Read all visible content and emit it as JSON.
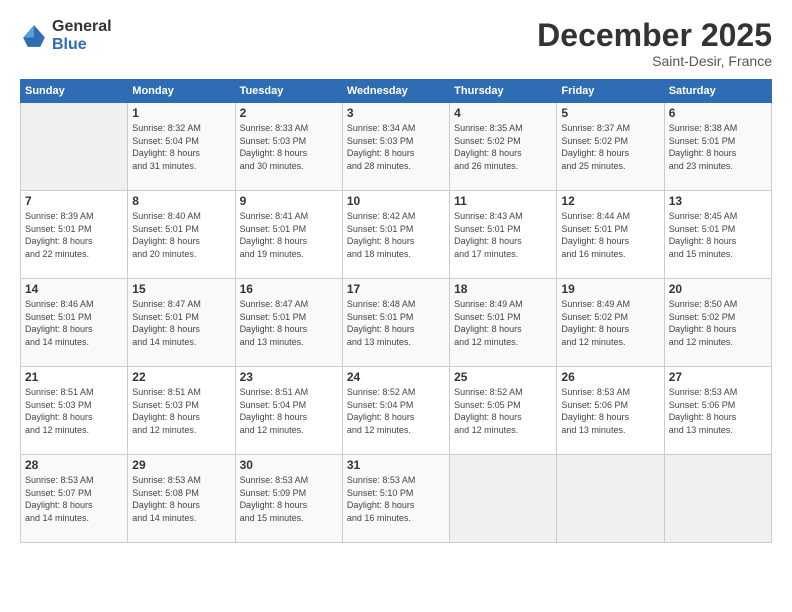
{
  "logo": {
    "general": "General",
    "blue": "Blue"
  },
  "title": "December 2025",
  "subtitle": "Saint-Desir, France",
  "weekdays": [
    "Sunday",
    "Monday",
    "Tuesday",
    "Wednesday",
    "Thursday",
    "Friday",
    "Saturday"
  ],
  "weeks": [
    [
      {
        "day": "",
        "info": ""
      },
      {
        "day": "1",
        "info": "Sunrise: 8:32 AM\nSunset: 5:04 PM\nDaylight: 8 hours\nand 31 minutes."
      },
      {
        "day": "2",
        "info": "Sunrise: 8:33 AM\nSunset: 5:03 PM\nDaylight: 8 hours\nand 30 minutes."
      },
      {
        "day": "3",
        "info": "Sunrise: 8:34 AM\nSunset: 5:03 PM\nDaylight: 8 hours\nand 28 minutes."
      },
      {
        "day": "4",
        "info": "Sunrise: 8:35 AM\nSunset: 5:02 PM\nDaylight: 8 hours\nand 26 minutes."
      },
      {
        "day": "5",
        "info": "Sunrise: 8:37 AM\nSunset: 5:02 PM\nDaylight: 8 hours\nand 25 minutes."
      },
      {
        "day": "6",
        "info": "Sunrise: 8:38 AM\nSunset: 5:01 PM\nDaylight: 8 hours\nand 23 minutes."
      }
    ],
    [
      {
        "day": "7",
        "info": "Sunrise: 8:39 AM\nSunset: 5:01 PM\nDaylight: 8 hours\nand 22 minutes."
      },
      {
        "day": "8",
        "info": "Sunrise: 8:40 AM\nSunset: 5:01 PM\nDaylight: 8 hours\nand 20 minutes."
      },
      {
        "day": "9",
        "info": "Sunrise: 8:41 AM\nSunset: 5:01 PM\nDaylight: 8 hours\nand 19 minutes."
      },
      {
        "day": "10",
        "info": "Sunrise: 8:42 AM\nSunset: 5:01 PM\nDaylight: 8 hours\nand 18 minutes."
      },
      {
        "day": "11",
        "info": "Sunrise: 8:43 AM\nSunset: 5:01 PM\nDaylight: 8 hours\nand 17 minutes."
      },
      {
        "day": "12",
        "info": "Sunrise: 8:44 AM\nSunset: 5:01 PM\nDaylight: 8 hours\nand 16 minutes."
      },
      {
        "day": "13",
        "info": "Sunrise: 8:45 AM\nSunset: 5:01 PM\nDaylight: 8 hours\nand 15 minutes."
      }
    ],
    [
      {
        "day": "14",
        "info": "Sunrise: 8:46 AM\nSunset: 5:01 PM\nDaylight: 8 hours\nand 14 minutes."
      },
      {
        "day": "15",
        "info": "Sunrise: 8:47 AM\nSunset: 5:01 PM\nDaylight: 8 hours\nand 14 minutes."
      },
      {
        "day": "16",
        "info": "Sunrise: 8:47 AM\nSunset: 5:01 PM\nDaylight: 8 hours\nand 13 minutes."
      },
      {
        "day": "17",
        "info": "Sunrise: 8:48 AM\nSunset: 5:01 PM\nDaylight: 8 hours\nand 13 minutes."
      },
      {
        "day": "18",
        "info": "Sunrise: 8:49 AM\nSunset: 5:01 PM\nDaylight: 8 hours\nand 12 minutes."
      },
      {
        "day": "19",
        "info": "Sunrise: 8:49 AM\nSunset: 5:02 PM\nDaylight: 8 hours\nand 12 minutes."
      },
      {
        "day": "20",
        "info": "Sunrise: 8:50 AM\nSunset: 5:02 PM\nDaylight: 8 hours\nand 12 minutes."
      }
    ],
    [
      {
        "day": "21",
        "info": "Sunrise: 8:51 AM\nSunset: 5:03 PM\nDaylight: 8 hours\nand 12 minutes."
      },
      {
        "day": "22",
        "info": "Sunrise: 8:51 AM\nSunset: 5:03 PM\nDaylight: 8 hours\nand 12 minutes."
      },
      {
        "day": "23",
        "info": "Sunrise: 8:51 AM\nSunset: 5:04 PM\nDaylight: 8 hours\nand 12 minutes."
      },
      {
        "day": "24",
        "info": "Sunrise: 8:52 AM\nSunset: 5:04 PM\nDaylight: 8 hours\nand 12 minutes."
      },
      {
        "day": "25",
        "info": "Sunrise: 8:52 AM\nSunset: 5:05 PM\nDaylight: 8 hours\nand 12 minutes."
      },
      {
        "day": "26",
        "info": "Sunrise: 8:53 AM\nSunset: 5:06 PM\nDaylight: 8 hours\nand 13 minutes."
      },
      {
        "day": "27",
        "info": "Sunrise: 8:53 AM\nSunset: 5:06 PM\nDaylight: 8 hours\nand 13 minutes."
      }
    ],
    [
      {
        "day": "28",
        "info": "Sunrise: 8:53 AM\nSunset: 5:07 PM\nDaylight: 8 hours\nand 14 minutes."
      },
      {
        "day": "29",
        "info": "Sunrise: 8:53 AM\nSunset: 5:08 PM\nDaylight: 8 hours\nand 14 minutes."
      },
      {
        "day": "30",
        "info": "Sunrise: 8:53 AM\nSunset: 5:09 PM\nDaylight: 8 hours\nand 15 minutes."
      },
      {
        "day": "31",
        "info": "Sunrise: 8:53 AM\nSunset: 5:10 PM\nDaylight: 8 hours\nand 16 minutes."
      },
      {
        "day": "",
        "info": ""
      },
      {
        "day": "",
        "info": ""
      },
      {
        "day": "",
        "info": ""
      }
    ]
  ]
}
